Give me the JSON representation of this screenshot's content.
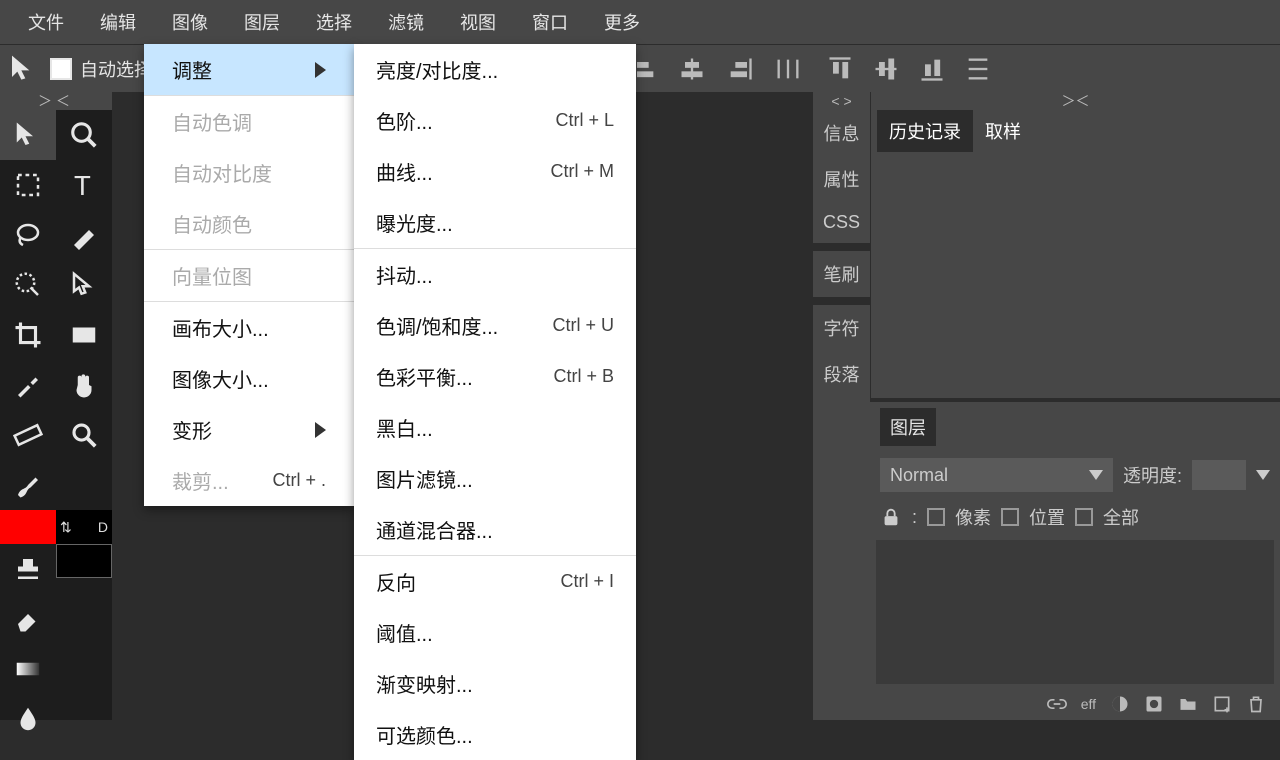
{
  "menubar": [
    "文件",
    "编辑",
    "图像",
    "图层",
    "选择",
    "滤镜",
    "视图",
    "窗口",
    "更多"
  ],
  "toolbar": {
    "autoLabel": "自动选择"
  },
  "leftTabs": [
    "信息",
    "属性",
    "CSS",
    "笔刷",
    "字符",
    "段落"
  ],
  "topPanel": {
    "tabs": [
      "历史记录",
      "取样"
    ],
    "active": 0
  },
  "layersPanel": {
    "title": "图层",
    "blend": "Normal",
    "opacityLabel": "透明度:",
    "lockLabels": [
      "像素",
      "位置",
      "全部"
    ]
  },
  "footer": {
    "eff": "eff"
  },
  "imageMenu": [
    {
      "label": "调整",
      "type": "submenu",
      "active": true
    },
    {
      "type": "sep"
    },
    {
      "label": "自动色调",
      "disabled": true
    },
    {
      "label": "自动对比度",
      "disabled": true
    },
    {
      "label": "自动颜色",
      "disabled": true
    },
    {
      "type": "sep"
    },
    {
      "label": "向量位图",
      "disabled": true
    },
    {
      "type": "sep"
    },
    {
      "label": "画布大小..."
    },
    {
      "label": "图像大小..."
    },
    {
      "label": "变形",
      "type": "submenu"
    },
    {
      "label": "裁剪...",
      "shortcut": "Ctrl + .",
      "disabled": true
    }
  ],
  "adjustMenu": [
    {
      "label": "亮度/对比度..."
    },
    {
      "label": "色阶...",
      "shortcut": "Ctrl + L"
    },
    {
      "label": "曲线...",
      "shortcut": "Ctrl + M"
    },
    {
      "label": "曝光度..."
    },
    {
      "type": "sep"
    },
    {
      "label": "抖动..."
    },
    {
      "label": "色调/饱和度...",
      "shortcut": "Ctrl + U"
    },
    {
      "label": "色彩平衡...",
      "shortcut": "Ctrl + B"
    },
    {
      "label": "黑白..."
    },
    {
      "label": "图片滤镜..."
    },
    {
      "label": "通道混合器..."
    },
    {
      "type": "sep"
    },
    {
      "label": "反向",
      "shortcut": "Ctrl + I"
    },
    {
      "label": "阈值..."
    },
    {
      "label": "渐变映射..."
    },
    {
      "label": "可选颜色..."
    }
  ]
}
